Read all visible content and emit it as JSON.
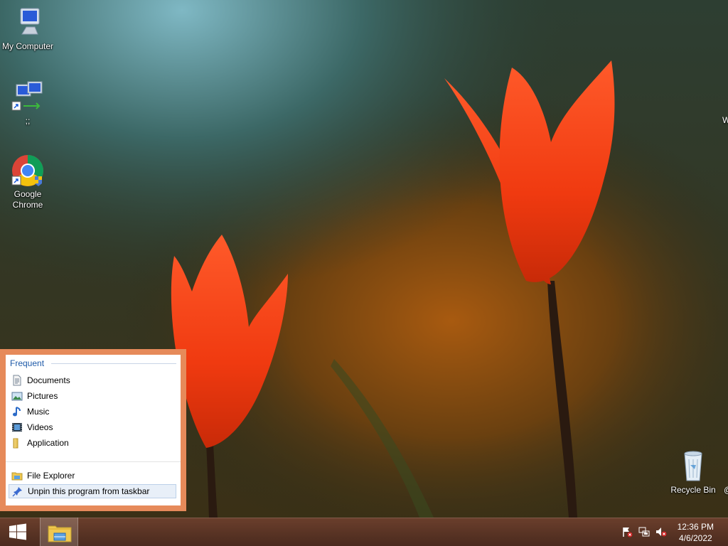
{
  "desktop": {
    "icons": [
      {
        "label": "My Computer",
        "icon": "computer-icon"
      },
      {
        "label": ";;",
        "icon": "network-computers-icon"
      },
      {
        "label": "Google Chrome",
        "icon": "chrome-icon"
      },
      {
        "label": "Recycle Bin",
        "icon": "recycle-bin-icon"
      }
    ],
    "edge_text_right": "W",
    "edge_text_bottom_right": "@"
  },
  "jumplist": {
    "header": "Frequent",
    "frequent_items": [
      {
        "label": "Documents",
        "icon": "document-icon"
      },
      {
        "label": "Pictures",
        "icon": "pictures-icon"
      },
      {
        "label": "Music",
        "icon": "music-note-icon"
      },
      {
        "label": "Videos",
        "icon": "video-film-icon"
      },
      {
        "label": "Application",
        "icon": "folder-icon"
      }
    ],
    "tasks": [
      {
        "label": "File Explorer",
        "icon": "file-explorer-icon"
      },
      {
        "label": "Unpin this program from taskbar",
        "icon": "unpin-icon"
      }
    ],
    "border_color": "#e68a5a"
  },
  "taskbar": {
    "start_icon": "windows-logo-icon",
    "pinned": [
      {
        "icon": "file-explorer-icon",
        "active": true
      }
    ],
    "tray_icons": [
      "action-center-flag-icon",
      "network-icon",
      "volume-muted-icon"
    ],
    "clock": {
      "time": "12:36 PM",
      "date": "4/6/2022"
    }
  }
}
